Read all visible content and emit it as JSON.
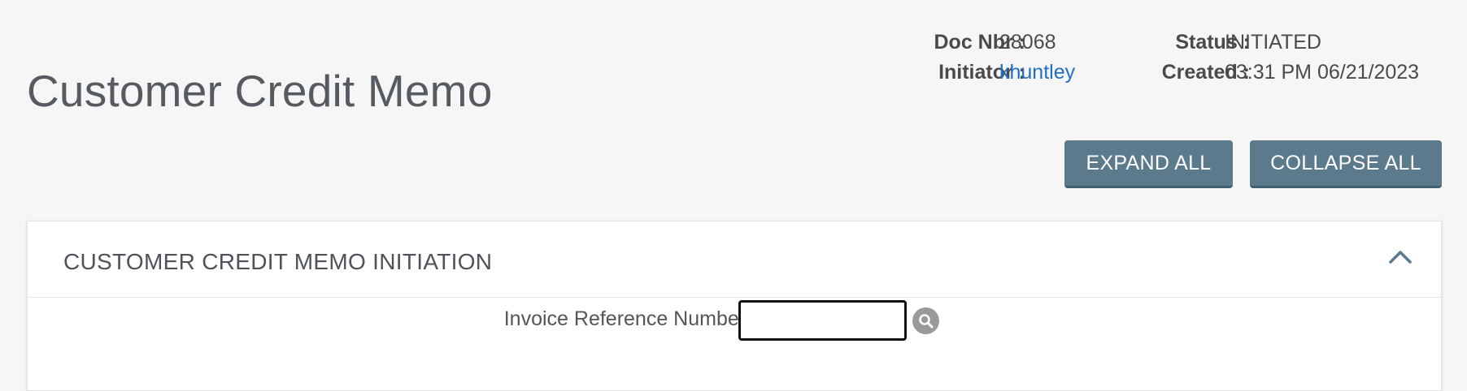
{
  "page": {
    "title": "Customer Credit Memo"
  },
  "doc_meta": {
    "doc_nbr_label": "Doc Nbr :",
    "doc_nbr_value": "28068",
    "initiator_label": "Initiator :",
    "initiator_value": "khuntley",
    "status_label": "Status :",
    "status_value": "INITIATED",
    "created_label": "Created :",
    "created_value": "03:31 PM 06/21/2023"
  },
  "toolbar": {
    "expand_all_label": "EXPAND ALL",
    "collapse_all_label": "COLLAPSE ALL"
  },
  "section": {
    "title": "CUSTOMER CREDIT MEMO INITIATION",
    "toggle_icon": "chevron-up-icon",
    "invoice_ref_label": "Invoice Reference Number :",
    "invoice_ref_value": "",
    "search_icon": "search-icon"
  },
  "colors": {
    "background": "#f6f6f6",
    "button": "#5b7a8c",
    "link": "#1f6fc5",
    "panel": "#ffffff"
  }
}
